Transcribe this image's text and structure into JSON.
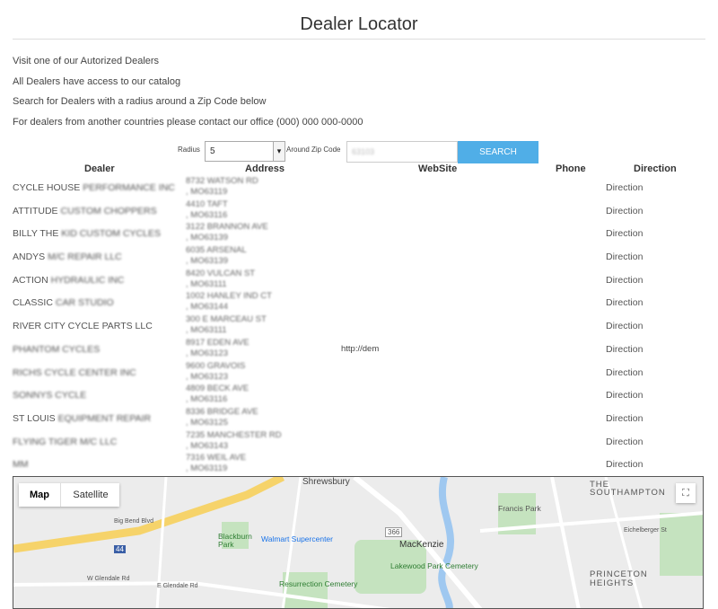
{
  "page": {
    "title": "Dealer Locator"
  },
  "intro": [
    "Visit one of our Autorized Dealers",
    "All Dealers have access to our catalog",
    "Search for Dealers with a radius around a Zip Code below",
    "For dealers from another countries please contact our office (000) 000 000-0000"
  ],
  "search": {
    "radius_label": "Radius",
    "radius_value": "5",
    "zip_label": "Around Zip Code",
    "zip_value": "63103",
    "button_label": "SEARCH"
  },
  "table": {
    "headers": {
      "dealer": "Dealer",
      "address": "Address",
      "website": "WebSite",
      "phone": "Phone",
      "direction": "Direction"
    },
    "rows": [
      {
        "dealer_visible": "CYCLE HOUSE",
        "dealer_blurred": "PERFORMANCE INC",
        "addr1": "8732 WATSON RD",
        "addr2": ", MO63119",
        "web": "",
        "direction": "Direction"
      },
      {
        "dealer_visible": "ATTITUDE",
        "dealer_blurred": "CUSTOM CHOPPERS",
        "addr1": "4410 TAFT",
        "addr2": ", MO63116",
        "web": "",
        "direction": "Direction"
      },
      {
        "dealer_visible": "BILLY THE",
        "dealer_blurred": "KID CUSTOM CYCLES",
        "addr1": "3122 BRANNON AVE",
        "addr2": ", MO63139",
        "web": "",
        "direction": "Direction"
      },
      {
        "dealer_visible": "ANDYS",
        "dealer_blurred": "M/C REPAIR LLC",
        "addr1": "6035 ARSENAL",
        "addr2": ", MO63139",
        "web": "",
        "direction": "Direction"
      },
      {
        "dealer_visible": "ACTION",
        "dealer_blurred": "HYDRAULIC INC",
        "addr1": "8420 VULCAN ST",
        "addr2": ", MO63111",
        "web": "",
        "direction": "Direction"
      },
      {
        "dealer_visible": "CLASSIC",
        "dealer_blurred": "CAR STUDIO",
        "addr1": "1002 HANLEY IND CT",
        "addr2": ", MO63144",
        "web": "",
        "direction": "Direction"
      },
      {
        "dealer_visible": "RIVER CITY CYCLE PARTS LLC",
        "dealer_blurred": "",
        "addr1": "300 E MARCEAU ST",
        "addr2": ", MO63111",
        "web": "",
        "direction": "Direction"
      },
      {
        "dealer_visible": "",
        "dealer_blurred": "PHANTOM CYCLES",
        "addr1": "8917 EDEN AVE",
        "addr2": ", MO63123",
        "web": "http://dem",
        "direction": "Direction"
      },
      {
        "dealer_visible": "",
        "dealer_blurred": "RICHS CYCLE CENTER INC",
        "addr1": "9600 GRAVOIS",
        "addr2": ", MO63123",
        "web": "",
        "direction": "Direction"
      },
      {
        "dealer_visible": "",
        "dealer_blurred": "SONNYS CYCLE",
        "addr1": "4809 BECK AVE",
        "addr2": ", MO63116",
        "web": "",
        "direction": "Direction"
      },
      {
        "dealer_visible": "ST LOUIS",
        "dealer_blurred": "EQUIPMENT REPAIR",
        "addr1": "8336 BRIDGE AVE",
        "addr2": ", MO63125",
        "web": "",
        "direction": "Direction"
      },
      {
        "dealer_visible": "",
        "dealer_blurred": "FLYING TIGER M/C LLC",
        "addr1": "7235 MANCHESTER RD",
        "addr2": ", MO63143",
        "web": "",
        "direction": "Direction"
      },
      {
        "dealer_visible": "",
        "dealer_blurred": "MM",
        "addr1": "7316 WEIL AVE",
        "addr2": ", MO63119",
        "web": "",
        "direction": "Direction"
      }
    ]
  },
  "map": {
    "tabs": [
      "Map",
      "Satellite"
    ],
    "active_tab": "Map",
    "labels": {
      "shrewsbury": "Shrewsbury",
      "southampton": "THE SOUTHAMPTON",
      "francis_park": "Francis Park",
      "blackburn_park": "Blackburn Park",
      "walmart": "Walmart Supercenter",
      "mackenzie": "MacKenzie",
      "lakewood": "Lakewood Park Cemetery",
      "resurrection": "Resurrection Cemetery",
      "princeton": "PRINCETON HEIGHTS",
      "glendale_w": "W Glendale Rd",
      "glendale_e": "E Glendale Rd",
      "big_bend": "Big Bend Blvd",
      "eichelberger": "Eichelberger St",
      "hwy44": "44",
      "hwy366": "366"
    }
  }
}
